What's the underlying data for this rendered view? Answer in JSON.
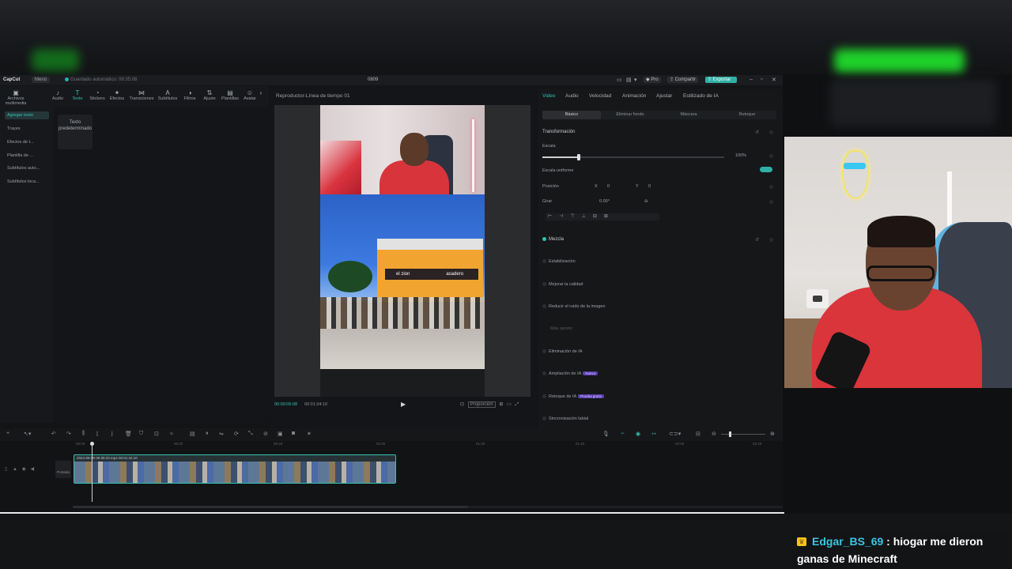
{
  "app": {
    "logo": "CapCut",
    "menu_label": "Menú",
    "autosave": "Guardado automático: 09:35:08",
    "project_name": "0809",
    "pro_label": "Pro",
    "share_label": "Compartir",
    "export_label": "Exportar"
  },
  "toolbar": {
    "items": [
      "Archivos multimedia",
      "Audio",
      "Texto",
      "Stickers",
      "Efectos",
      "Transiciones",
      "Subtítulos",
      "Filtros",
      "Ajuste",
      "Plantillas",
      "Avatar"
    ],
    "active": "Texto"
  },
  "left_nav": {
    "items": [
      "Agregar texto",
      "Trayes",
      "Efectos de t...",
      "Plantilla de ...",
      "Subtítulos auto...",
      "Subtítulos loca..."
    ]
  },
  "assets": {
    "text_card": "Texto predeterminado"
  },
  "player": {
    "title": "Reproductor-Línea de tiempo 01",
    "current_time": "00:00:05:08",
    "total_time": "00:01:34:10",
    "ratio_label": "Proporción",
    "sign_text": "el zion",
    "sign_text2": "asadero"
  },
  "properties": {
    "tabs": [
      "Video",
      "Audio",
      "Velocidad",
      "Animación",
      "Ajustar",
      "Estilizado de IA"
    ],
    "active_tab": "Video",
    "subtabs": [
      "Básico",
      "Eliminar fondo",
      "Máscara",
      "Retoque"
    ],
    "active_subtab": "Básico",
    "transform_label": "Transformación",
    "scale_label": "Escala",
    "scale_value": "100%",
    "uniform_scale_label": "Escala uniforme",
    "position_label": "Posición",
    "pos_x_label": "X",
    "pos_x": "0",
    "pos_y_label": "Y",
    "pos_y": "0",
    "rotate_label": "Girar",
    "rotate_value": "0.00°",
    "blend_label": "Mezcla",
    "stabilize_label": "Estabilización",
    "enhance_label": "Mejorar la calidad",
    "denoise_label": "Reducir el ruido de la imagen",
    "denoise_sub": "Más opción",
    "ai_remove_label": "Eliminación de IA",
    "ai_expand_label": "Ampliación de IA",
    "ai_expand_badge": "Nuevo",
    "ai_retouch_label": "Retoque de IA",
    "ai_retouch_badge": "Prueba gratis",
    "lip_sync_label": "Sincronización labial"
  },
  "timeline": {
    "ruler": [
      "00:00",
      "00:20",
      "00:40",
      "01:00",
      "01:20",
      "01:40",
      "02:00",
      "02:20"
    ],
    "cover_label": "Portada",
    "clip_label": "2024-08-09 09:35:20.mp4  00:01:34:10"
  },
  "chat": {
    "username": "Edgar_BS_69",
    "colon": ":",
    "message_line1": "hiogar me dieron",
    "message_line2": "ganas de Minecraft"
  },
  "colors": {
    "accent": "#33c2b3",
    "chat_user": "#38c8e2",
    "highlight_green": "#1fd02a"
  }
}
